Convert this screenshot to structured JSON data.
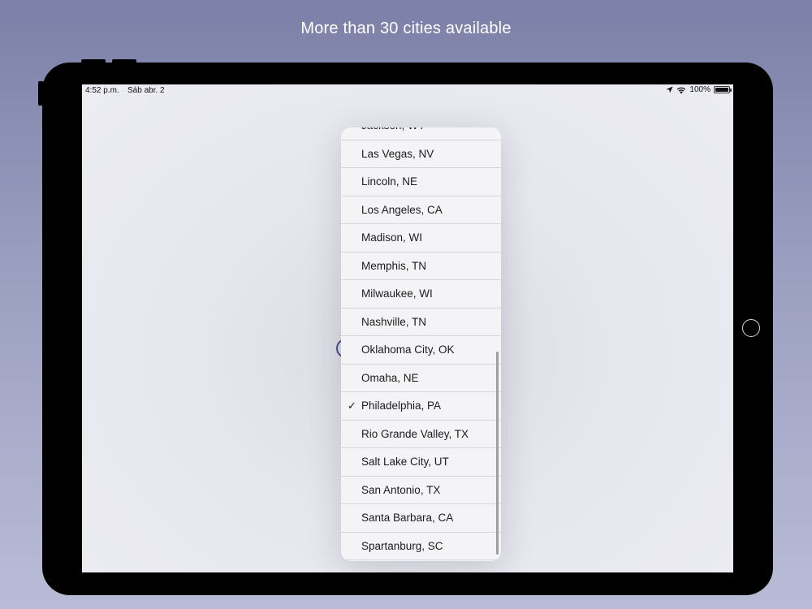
{
  "headline": "More than 30 cities available",
  "status_bar": {
    "time": "4:52 p.m.",
    "date": "Sáb abr. 2",
    "battery": "100%"
  },
  "city_list": {
    "items": [
      {
        "label": "Jackson, WY",
        "selected": false
      },
      {
        "label": "Las Vegas, NV",
        "selected": false
      },
      {
        "label": "Lincoln, NE",
        "selected": false
      },
      {
        "label": "Los Angeles, CA",
        "selected": false
      },
      {
        "label": "Madison, WI",
        "selected": false
      },
      {
        "label": "Memphis, TN",
        "selected": false
      },
      {
        "label": "Milwaukee, WI",
        "selected": false
      },
      {
        "label": "Nashville, TN",
        "selected": false
      },
      {
        "label": "Oklahoma City, OK",
        "selected": false
      },
      {
        "label": "Omaha, NE",
        "selected": false
      },
      {
        "label": "Philadelphia, PA",
        "selected": true
      },
      {
        "label": "Rio Grande Valley, TX",
        "selected": false
      },
      {
        "label": "Salt Lake City, UT",
        "selected": false
      },
      {
        "label": "San Antonio, TX",
        "selected": false
      },
      {
        "label": "Santa Barbara, CA",
        "selected": false
      },
      {
        "label": "Spartanburg, SC",
        "selected": false
      }
    ],
    "check_glyph": "✓"
  }
}
